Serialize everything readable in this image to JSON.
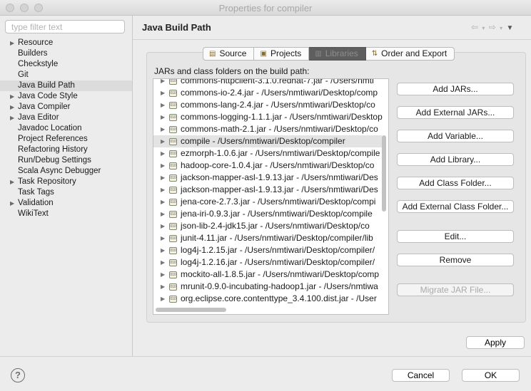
{
  "window": {
    "title": "Properties for compiler"
  },
  "filter": {
    "placeholder": "type filter text",
    "value": ""
  },
  "tree": [
    {
      "label": "Resource",
      "expandable": true
    },
    {
      "label": "Builders",
      "expandable": false
    },
    {
      "label": "Checkstyle",
      "expandable": false
    },
    {
      "label": "Git",
      "expandable": false
    },
    {
      "label": "Java Build Path",
      "expandable": false,
      "selected": true
    },
    {
      "label": "Java Code Style",
      "expandable": true
    },
    {
      "label": "Java Compiler",
      "expandable": true
    },
    {
      "label": "Java Editor",
      "expandable": true
    },
    {
      "label": "Javadoc Location",
      "expandable": false
    },
    {
      "label": "Project References",
      "expandable": false
    },
    {
      "label": "Refactoring History",
      "expandable": false
    },
    {
      "label": "Run/Debug Settings",
      "expandable": false
    },
    {
      "label": "Scala Async Debugger",
      "expandable": false
    },
    {
      "label": "Task Repository",
      "expandable": true
    },
    {
      "label": "Task Tags",
      "expandable": false
    },
    {
      "label": "Validation",
      "expandable": true
    },
    {
      "label": "WikiText",
      "expandable": false
    }
  ],
  "page": {
    "title": "Java Build Path"
  },
  "tabs": [
    {
      "label": "Source",
      "icon": "source-folder-icon"
    },
    {
      "label": "Projects",
      "icon": "projects-folder-icon"
    },
    {
      "label": "Libraries",
      "icon": "libraries-icon",
      "active": true
    },
    {
      "label": "Order and Export",
      "icon": "order-export-icon"
    }
  ],
  "list_label": "JARs and class folders on the build path:",
  "jars": [
    "commons-httpclient-3.1.0.redhat-7.jar - /Users/nmti",
    "commons-io-2.4.jar - /Users/nmtiwari/Desktop/comp",
    "commons-lang-2.4.jar - /Users/nmtiwari/Desktop/co",
    "commons-logging-1.1.1.jar - /Users/nmtiwari/Desktop",
    "commons-math-2.1.jar - /Users/nmtiwari/Desktop/co",
    "compile - /Users/nmtiwari/Desktop/compiler",
    "ezmorph-1.0.6.jar - /Users/nmtiwari/Desktop/compile",
    "hadoop-core-1.0.4.jar - /Users/nmtiwari/Desktop/co",
    "jackson-mapper-asl-1.9.13.jar - /Users/nmtiwari/Des",
    "jackson-mapper-asl-1.9.13.jar - /Users/nmtiwari/Des",
    "jena-core-2.7.3.jar - /Users/nmtiwari/Desktop/compi",
    "jena-iri-0.9.3.jar - /Users/nmtiwari/Desktop/compile",
    "json-lib-2.4-jdk15.jar - /Users/nmtiwari/Desktop/co",
    "junit-4.11.jar - /Users/nmtiwari/Desktop/compiler/lib",
    "log4j-1.2.15.jar - /Users/nmtiwari/Desktop/compiler/",
    "log4j-1.2.16.jar - /Users/nmtiwari/Desktop/compiler/",
    "mockito-all-1.8.5.jar - /Users/nmtiwari/Desktop/comp",
    "mrunit-0.9.0-incubating-hadoop1.jar - /Users/nmtiwa",
    "org.eclipse.core.contenttype_3.4.100.dist.jar - /User"
  ],
  "selected_jar_index": 5,
  "buttons": {
    "add_jars": "Add JARs...",
    "add_external_jars": "Add External JARs...",
    "add_variable": "Add Variable...",
    "add_library": "Add Library...",
    "add_class_folder": "Add Class Folder...",
    "add_external_class_folder": "Add External Class Folder...",
    "edit": "Edit...",
    "remove": "Remove",
    "migrate_jar": "Migrate JAR File...",
    "apply": "Apply",
    "cancel": "Cancel",
    "ok": "OK"
  },
  "help_icon": "?"
}
